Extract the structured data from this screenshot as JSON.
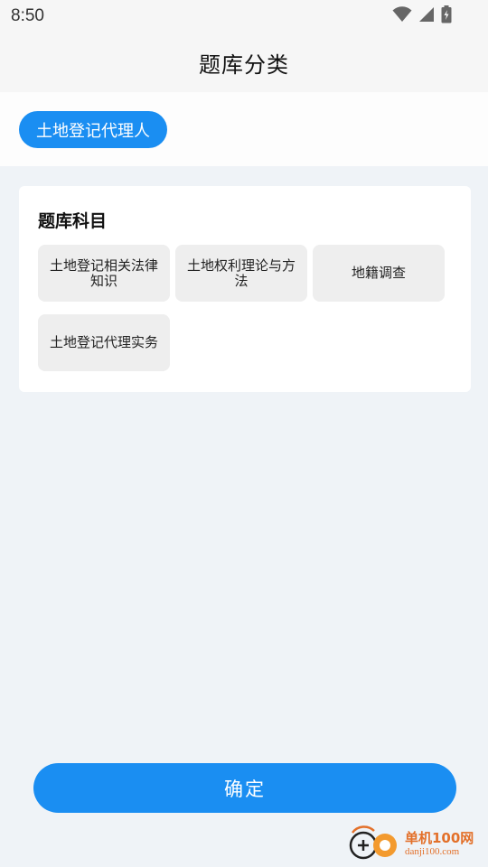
{
  "status_bar": {
    "time": "8:50",
    "icons": [
      "wifi-icon",
      "signal-icon",
      "battery-icon"
    ]
  },
  "header": {
    "title": "题库分类"
  },
  "category": {
    "selected_label": "土地登记代理人"
  },
  "subject_card": {
    "title": "题库科目",
    "items": [
      {
        "label": "土地登记相关法律知识"
      },
      {
        "label": "土地权利理论与方法"
      },
      {
        "label": "地籍调查"
      },
      {
        "label": "土地登记代理实务"
      }
    ]
  },
  "actions": {
    "confirm_label": "确定"
  },
  "watermark": {
    "line1": "单机100网",
    "line2": "danji100.com"
  },
  "colors": {
    "accent": "#1a8ef2",
    "background": "#eff3f7",
    "chip_bg": "#eeeeee",
    "watermark": "#e3702a"
  }
}
